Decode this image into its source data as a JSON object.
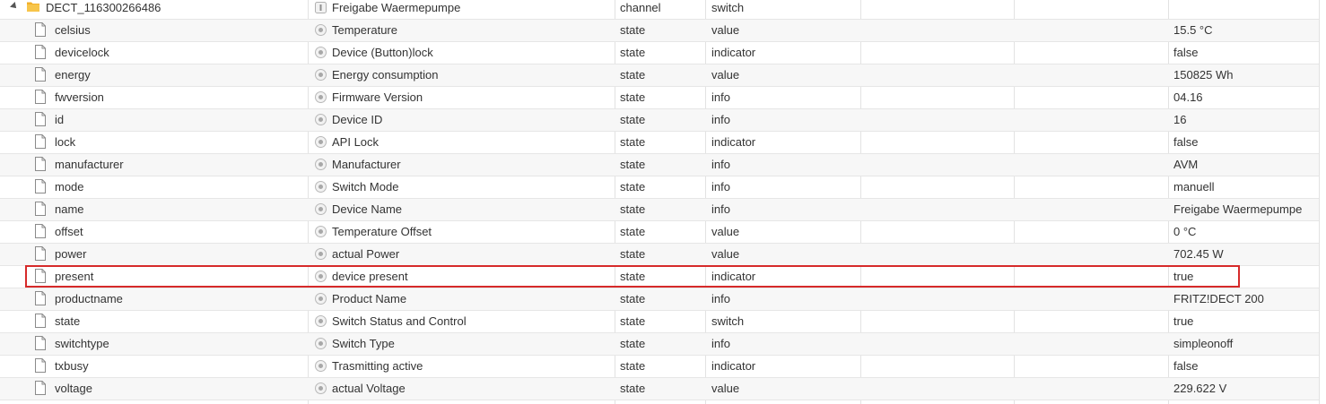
{
  "colors": {
    "highlight": "#d62a2a",
    "folder": "#f2b02a",
    "grid": "#e2e2e2"
  },
  "channel": {
    "name": "DECT_116300266486",
    "title": "Freigabe Waermepumpe",
    "type": "channel",
    "role": "switch",
    "icons": [
      "expand-caret-icon",
      "folder-icon",
      "channel-icon"
    ]
  },
  "states": [
    {
      "name": "celsius",
      "title": "Temperature",
      "type": "state",
      "role": "value",
      "value": "15.5 °C"
    },
    {
      "name": "devicelock",
      "title": "Device (Button)lock",
      "type": "state",
      "role": "indicator",
      "value": "false"
    },
    {
      "name": "energy",
      "title": "Energy consumption",
      "type": "state",
      "role": "value",
      "value": "150825 Wh"
    },
    {
      "name": "fwversion",
      "title": "Firmware Version",
      "type": "state",
      "role": "info",
      "value": "04.16"
    },
    {
      "name": "id",
      "title": "Device ID",
      "type": "state",
      "role": "info",
      "value": "16"
    },
    {
      "name": "lock",
      "title": "API Lock",
      "type": "state",
      "role": "indicator",
      "value": "false"
    },
    {
      "name": "manufacturer",
      "title": "Manufacturer",
      "type": "state",
      "role": "info",
      "value": "AVM"
    },
    {
      "name": "mode",
      "title": "Switch Mode",
      "type": "state",
      "role": "info",
      "value": "manuell"
    },
    {
      "name": "name",
      "title": "Device Name",
      "type": "state",
      "role": "info",
      "value": "Freigabe Waermepumpe"
    },
    {
      "name": "offset",
      "title": "Temperature Offset",
      "type": "state",
      "role": "value",
      "value": "0 °C"
    },
    {
      "name": "power",
      "title": "actual Power",
      "type": "state",
      "role": "value",
      "value": "702.45 W"
    },
    {
      "name": "present",
      "title": "device present",
      "type": "state",
      "role": "indicator",
      "value": "true",
      "highlighted": true
    },
    {
      "name": "productname",
      "title": "Product Name",
      "type": "state",
      "role": "info",
      "value": "FRITZ!DECT 200"
    },
    {
      "name": "state",
      "title": "Switch Status and Control",
      "type": "state",
      "role": "switch",
      "value": "true"
    },
    {
      "name": "switchtype",
      "title": "Switch Type",
      "type": "state",
      "role": "info",
      "value": "simpleonoff"
    },
    {
      "name": "txbusy",
      "title": "Trasmitting active",
      "type": "state",
      "role": "indicator",
      "value": "false"
    },
    {
      "name": "voltage",
      "title": "actual Voltage",
      "type": "state",
      "role": "value",
      "value": "229.622 V"
    }
  ]
}
